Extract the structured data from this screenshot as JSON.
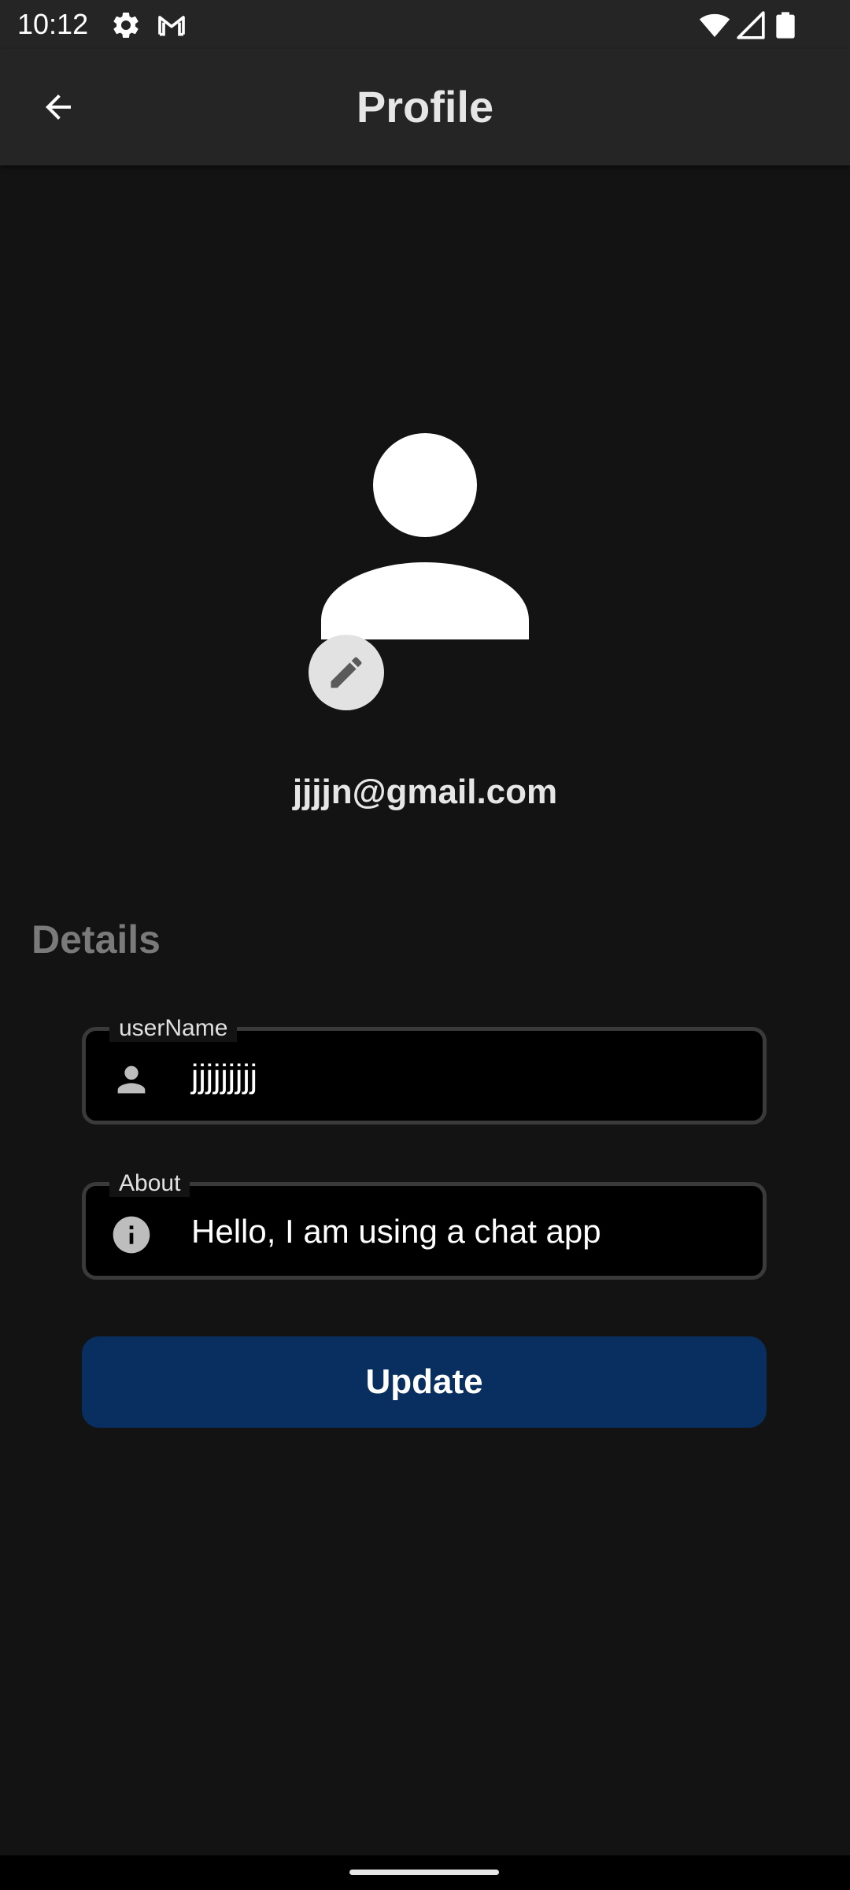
{
  "status_bar": {
    "time": "10:12",
    "left_icons": [
      "gear-icon",
      "gmail-icon"
    ],
    "right_icons": [
      "wifi-icon",
      "signal-icon",
      "battery-icon"
    ]
  },
  "app_bar": {
    "back_icon": "arrow-left-icon",
    "title": "Profile"
  },
  "profile": {
    "avatar_icon": "person-icon",
    "edit_icon": "pencil-icon",
    "email": "jjjjn@gmail.com"
  },
  "details": {
    "section_title": "Details",
    "username": {
      "label": "userName",
      "value": "jjjjjjjjj",
      "icon": "person-icon"
    },
    "about": {
      "label": "About",
      "value": "Hello, I am using a chat app",
      "icon": "info-icon"
    },
    "update_label": "Update"
  },
  "colors": {
    "background": "#131313",
    "app_bar": "#252525",
    "field_background": "#000000",
    "field_border": "#3a3a3a",
    "button": "#082f5f",
    "section_title": "#7a7a7a"
  }
}
